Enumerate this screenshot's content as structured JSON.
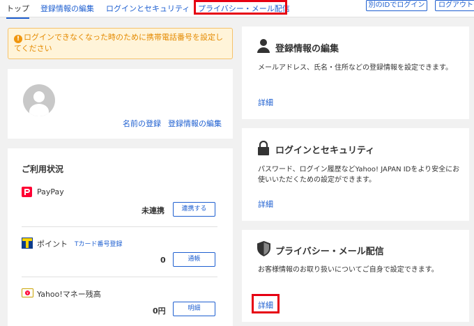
{
  "nav": {
    "tabs": [
      "トップ",
      "登録情報の編集",
      "ログインとセキュリティ",
      "プライバシー・メール配信"
    ],
    "switch_id_label": "別のIDでログイン",
    "logout_label": "ログアウト"
  },
  "warning": {
    "text": "ログインできなくなった時のために携帯電話番号を設定してください"
  },
  "profile": {
    "name_register_link": "名前の登録",
    "edit_link": "登録情報の編集"
  },
  "usage": {
    "heading": "ご利用状況",
    "items": [
      {
        "name": "PayPay",
        "value": "未連携",
        "button": "連携する"
      },
      {
        "name": "ポイント",
        "sub_link": "Tカード番号登録",
        "value": "0",
        "button": "通帳"
      },
      {
        "name": "Yahoo!マネー残高",
        "value": "0円",
        "button": "明細"
      }
    ]
  },
  "right_cards": [
    {
      "title": "登録情報の編集",
      "description": "メールアドレス、氏名・住所などの登録情報を設定できます。",
      "link": "詳細"
    },
    {
      "title": "ログインとセキュリティ",
      "description": "パスワード、ログイン履歴などYahoo! JAPAN IDをより安全にお使いいただくための設定ができます。",
      "link": "詳細"
    },
    {
      "title": "プライバシー・メール配信",
      "description": "お客様情報のお取り扱いについてご自身で設定できます。",
      "link": "詳細"
    }
  ],
  "colors": {
    "link": "#1e5fd0",
    "highlight": "#e60012",
    "warning_text": "#e48a00",
    "warning_bg": "#fff4d9"
  }
}
